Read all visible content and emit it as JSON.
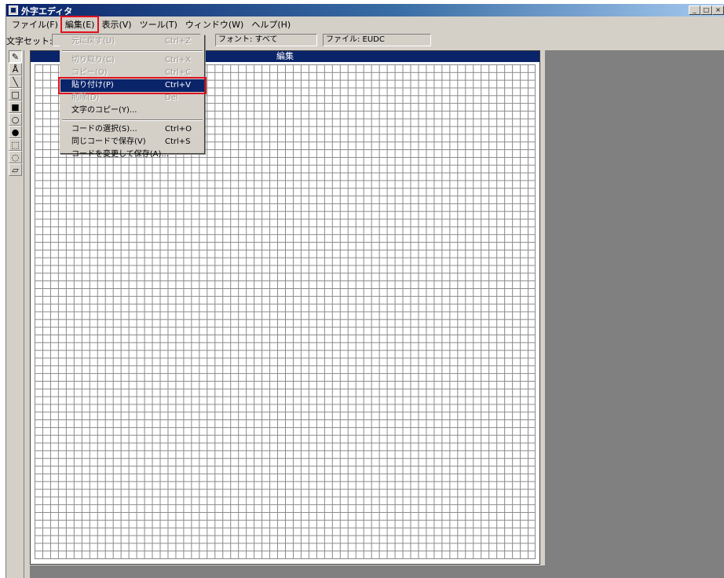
{
  "window": {
    "title": "外字エディタ",
    "controls": {
      "minimize": "_",
      "maximize": "□",
      "close": "×"
    }
  },
  "menubar": [
    {
      "label": "ファイル(F)"
    },
    {
      "label": "編集(E)",
      "active": true
    },
    {
      "label": "表示(V)"
    },
    {
      "label": "ツール(T)"
    },
    {
      "label": "ウィンドウ(W)"
    },
    {
      "label": "ヘルプ(H)"
    }
  ],
  "infobar": {
    "charset_label": "文字セット:",
    "font_label": "フォント: すべて",
    "file_label": "ファイル: EUDC"
  },
  "tools": [
    {
      "icon": "pencil-icon",
      "glyph": "✎"
    },
    {
      "icon": "brush-icon",
      "glyph": "Å"
    },
    {
      "icon": "line-icon",
      "glyph": "╲"
    },
    {
      "icon": "hollow-rect-icon",
      "glyph": "□"
    },
    {
      "icon": "filled-rect-icon",
      "glyph": "■"
    },
    {
      "icon": "hollow-ellipse-icon",
      "glyph": "○"
    },
    {
      "icon": "filled-ellipse-icon",
      "glyph": "●"
    },
    {
      "icon": "rect-select-icon",
      "glyph": "⬚"
    },
    {
      "icon": "freeform-select-icon",
      "glyph": "◌"
    },
    {
      "icon": "eraser-icon",
      "glyph": "▱"
    }
  ],
  "editor": {
    "title": "編集",
    "grid_columns": 64,
    "grid_rows": 64
  },
  "edit_menu": {
    "undo": {
      "label": "元に戻す(U)",
      "shortcut": "Ctrl+Z"
    },
    "cut": {
      "label": "切り取り(C)",
      "shortcut": "Ctrl+X"
    },
    "copy": {
      "label": "コピー(O)",
      "shortcut": "Ctrl+C"
    },
    "paste": {
      "label": "貼り付け(P)",
      "shortcut": "Ctrl+V"
    },
    "delete": {
      "label": "削除(D)",
      "shortcut": "Del"
    },
    "copy_char": {
      "label": "文字のコピー(Y)..."
    },
    "select_code": {
      "label": "コードの選択(S)...",
      "shortcut": "Ctrl+O"
    },
    "save_same": {
      "label": "同じコードで保存(V)",
      "shortcut": "Ctrl+S"
    },
    "save_as": {
      "label": "コードを変更して保存(A)..."
    }
  },
  "colors": {
    "accent": "#0a246a",
    "highlight_frame": "#e01020",
    "face": "#d4d0c8",
    "workspace": "#808080"
  }
}
